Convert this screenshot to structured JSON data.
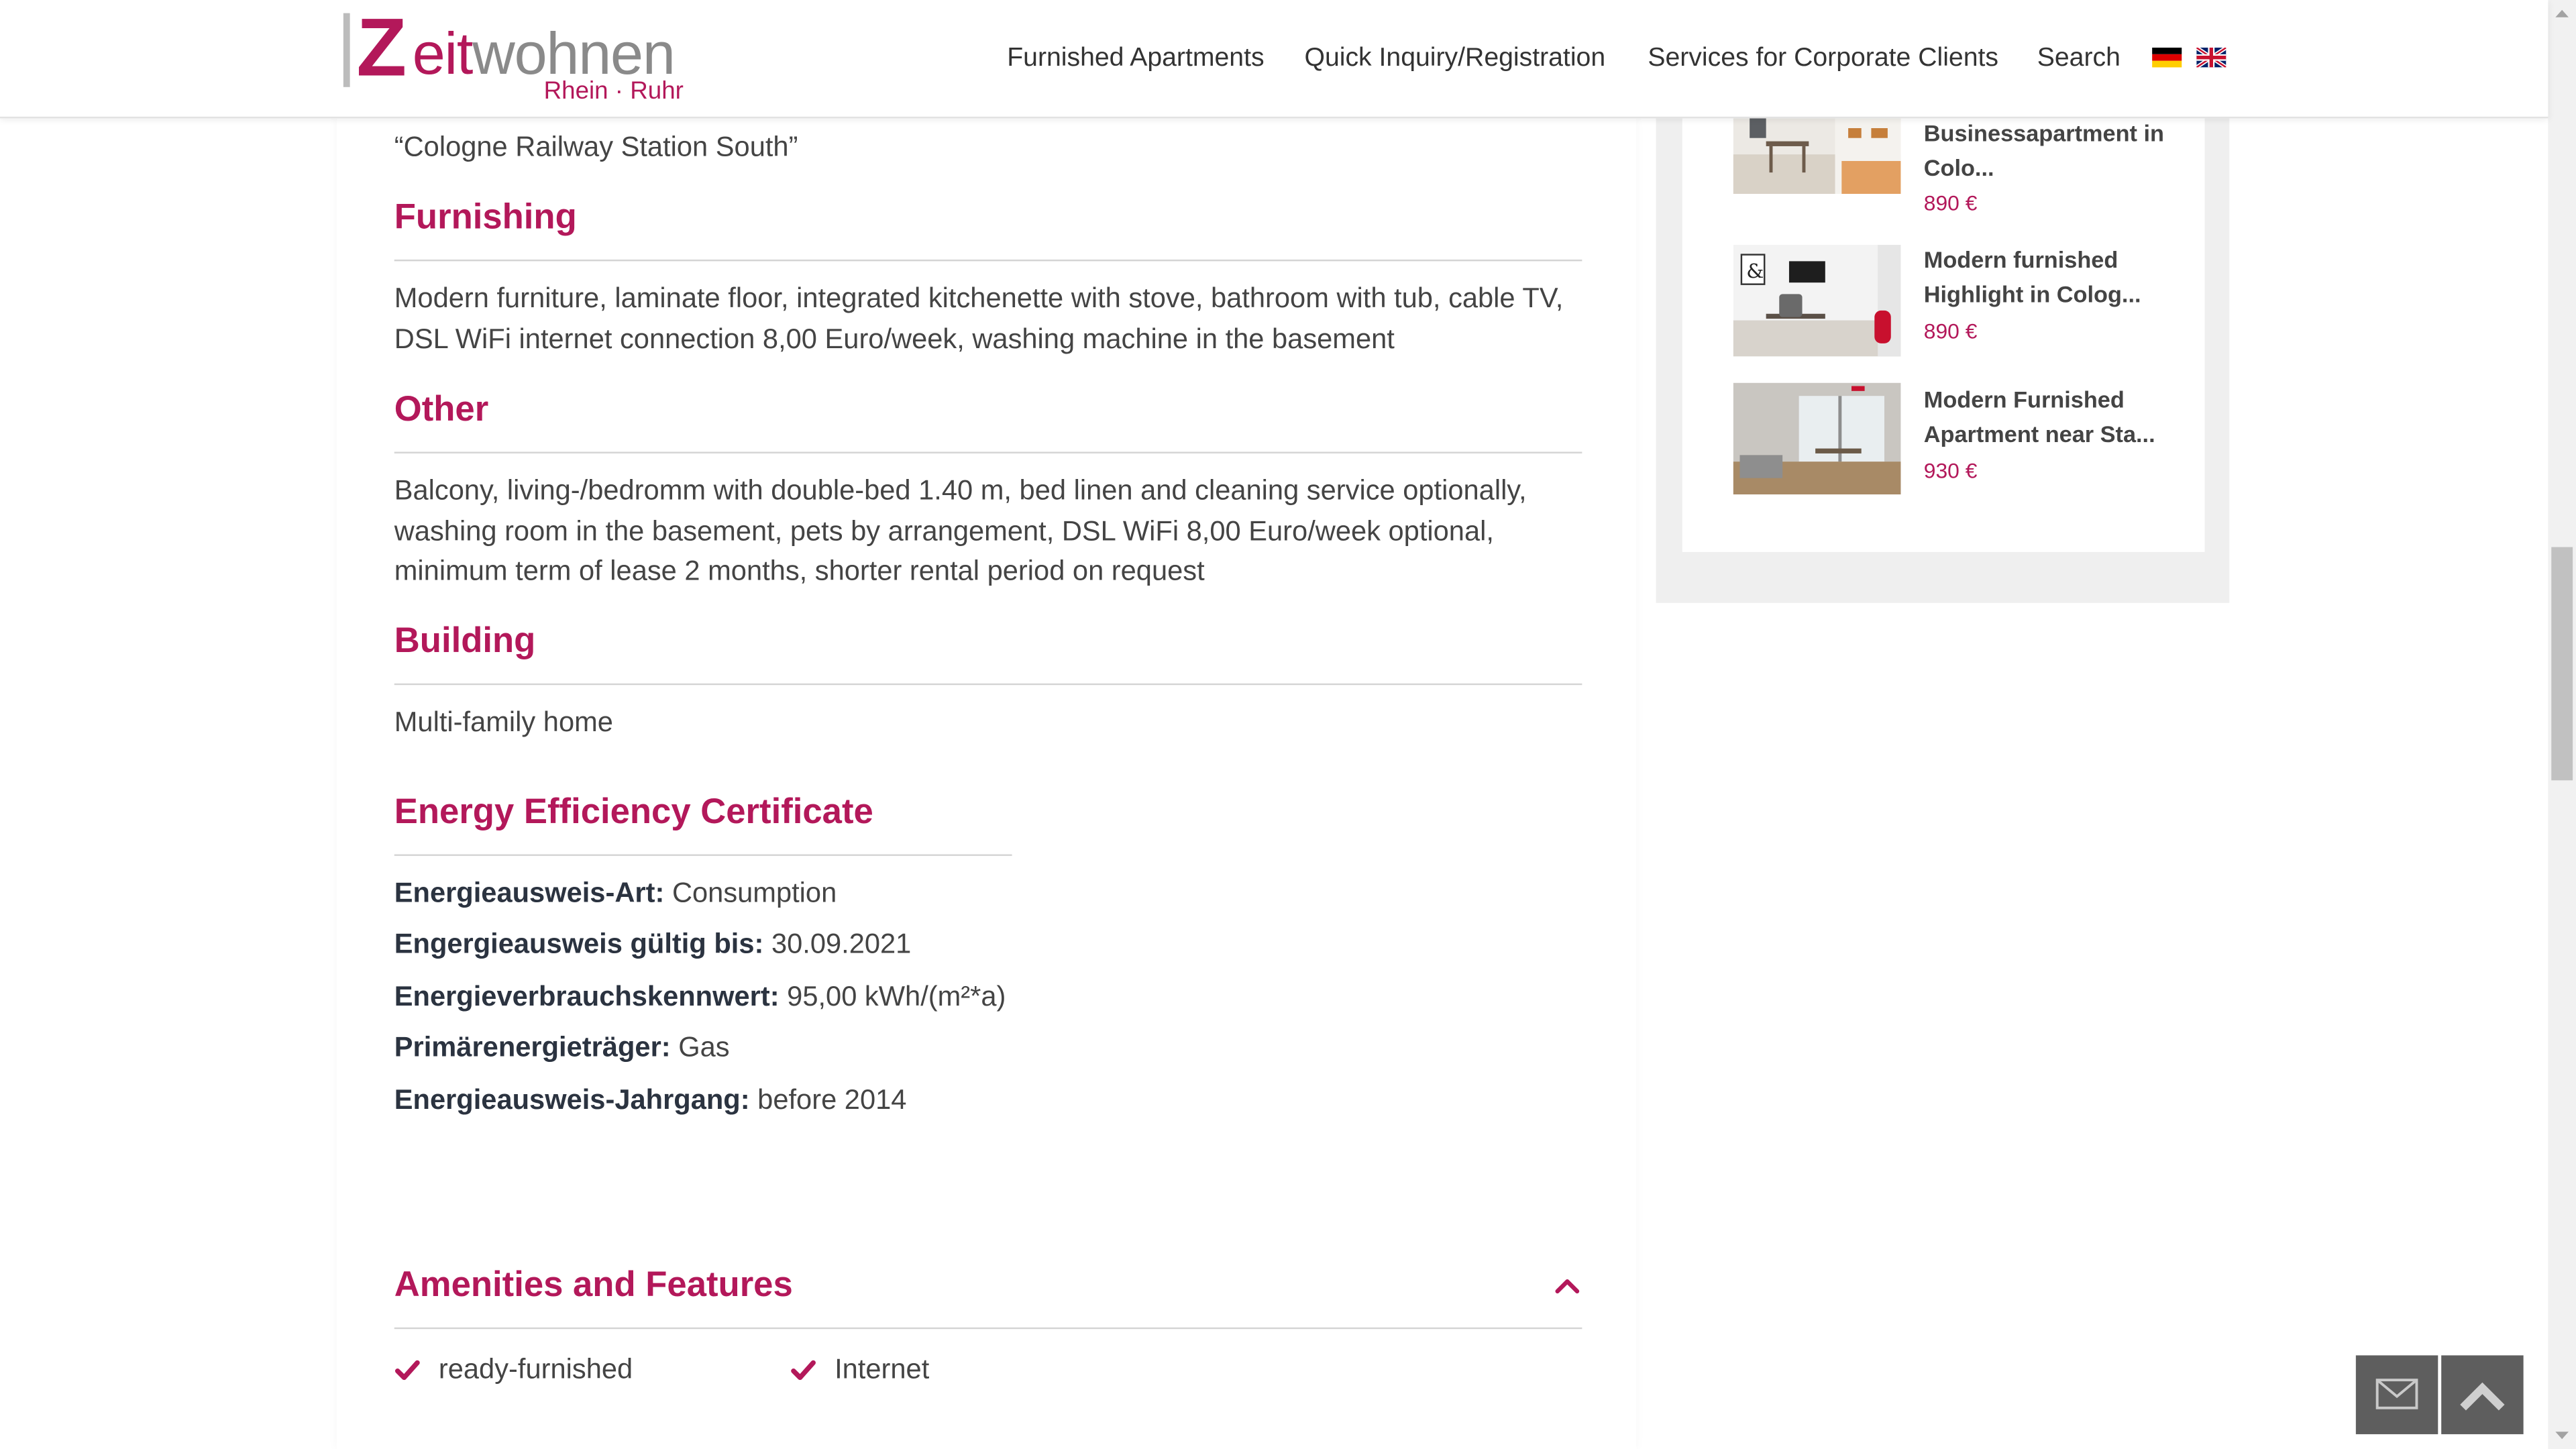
{
  "header": {
    "logo_z": "Z",
    "logo_eit": "eit",
    "logo_wohnen": "wohnen",
    "logo_region": "Rhein · Ruhr",
    "nav": [
      {
        "label": "Furnished Apartments"
      },
      {
        "label": "Quick Inquiry/Registration"
      },
      {
        "label": "Services for Corporate Clients"
      },
      {
        "label": "Search"
      }
    ],
    "languages": [
      "de-flag-icon",
      "uk-flag-icon"
    ]
  },
  "main": {
    "partial_line": "“Cologne Railway Station South”",
    "furnishing": {
      "title": "Furnishing",
      "text": "Modern furniture, laminate floor, integrated kitchenette with stove, bathroom with tub, cable TV, DSL WiFi internet connection 8,00 Euro/week, washing machine in the basement"
    },
    "other": {
      "title": "Other",
      "text": "Balcony, living-/bedromm with double-bed 1.40 m, bed linen and cleaning service optionally, washing room in the basement, pets by arrangement, DSL WiFi 8,00 Euro/week optional, minimum term of lease 2 months, shorter rental period on request"
    },
    "building": {
      "title": "Building",
      "text": "Multi-family home"
    },
    "energy": {
      "title": "Energy Efficiency Certificate",
      "rows": [
        {
          "label": "Energieausweis-Art:",
          "value": "Consumption"
        },
        {
          "label": "Engergieausweis gültig bis:",
          "value": "30.09.2021"
        },
        {
          "label": "Energieverbrauchskennwert:",
          "value": "95,00 kWh/(m²*a)"
        },
        {
          "label": "Primärenergieträger:",
          "value": "Gas"
        },
        {
          "label": "Energieausweis-Jahrgang:",
          "value": "before 2014"
        }
      ]
    },
    "amenities": {
      "title": "Amenities and Features",
      "items": [
        "ready-furnished",
        "Internet"
      ]
    }
  },
  "sidebar": {
    "listings": [
      {
        "title": "Businessapartment in Colo...",
        "price": "890 €"
      },
      {
        "title": "Modern furnished Highlight in Colog...",
        "price": "890 €"
      },
      {
        "title": "Modern Furnished Apartment near Sta...",
        "price": "930 €"
      }
    ]
  },
  "colors": {
    "accent": "#b3185a",
    "text": "#444444",
    "label": "#2b3340",
    "button": "#5e5e5e"
  },
  "floating": {
    "contact_icon": "envelope-icon",
    "top_icon": "chevron-up-icon"
  }
}
